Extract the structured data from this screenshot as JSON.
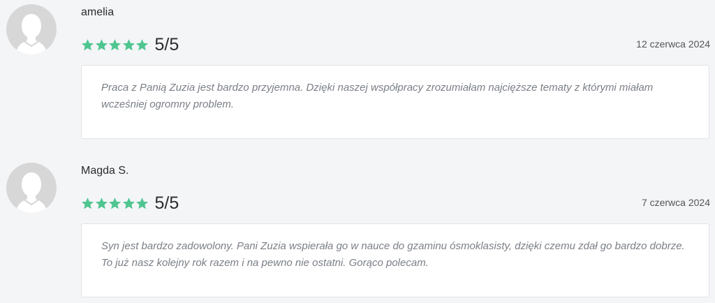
{
  "colors": {
    "star": "#4fc590",
    "avatar_bg": "#d7d7d7",
    "avatar_fg": "#ffffff"
  },
  "reviews": [
    {
      "author": "amelia",
      "score_text": "5/5",
      "stars": 5,
      "date": "12 czerwca 2024",
      "body": "Praca z Panią Zuzia jest bardzo przyjemna. Dzięki naszej współpracy zrozumiałam najcięższe tematy z którymi miałam wcześniej ogromny problem."
    },
    {
      "author": "Magda S.",
      "score_text": "5/5",
      "stars": 5,
      "date": "7 czerwca 2024",
      "body": "Syn jest bardzo zadowolony. Pani Zuzia wspierała go w nauce do gzaminu ósmoklasisty, dzięki czemu zdał go bardzo dobrze. To już nasz kolejny rok razem i na pewno nie ostatni. Gorąco polecam."
    }
  ]
}
